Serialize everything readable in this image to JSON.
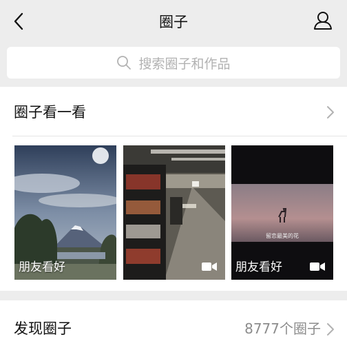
{
  "header": {
    "title": "圈子",
    "back_icon": "back-chevron-icon",
    "profile_icon": "user-icon"
  },
  "search": {
    "placeholder": "搜索圈子和作品",
    "icon": "search-icon"
  },
  "browse_section": {
    "title": "圈子看一看",
    "cards": [
      {
        "caption": "朋友看好",
        "scene": "mount-fuji-landscape",
        "has_video": false
      },
      {
        "caption": "",
        "scene": "library-bookshelves",
        "has_video": true
      },
      {
        "caption": "朋友看好",
        "scene": "deer-on-beach",
        "has_video": true,
        "overlay_text": "留恋最美的花"
      }
    ]
  },
  "discover": {
    "title": "发现圈子",
    "count_label": "8777个圈子"
  }
}
